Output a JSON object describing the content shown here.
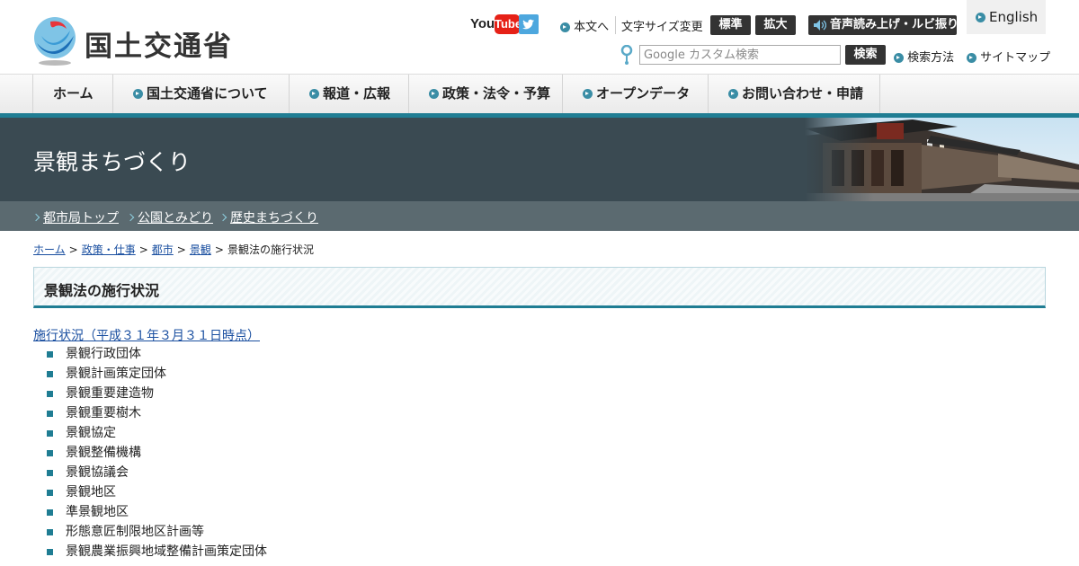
{
  "header": {
    "logo_text": "国土交通省",
    "youtube_you": "You",
    "youtube_tube": "Tube",
    "skip_link": "本文へ",
    "font_size_label": "文字サイズ変更",
    "font_standard": "標準",
    "font_large": "拡大",
    "voice_button": "音声読み上げ・ルビ振り",
    "english": "English",
    "search_placeholder": "Google カスタム検索",
    "search_button": "検索",
    "search_help": "検索方法",
    "sitemap": "サイトマップ"
  },
  "nav": {
    "items": [
      {
        "label": "ホーム"
      },
      {
        "label": "国土交通省について"
      },
      {
        "label": "報道・広報"
      },
      {
        "label": "政策・法令・予算"
      },
      {
        "label": "オープンデータ"
      },
      {
        "label": "お問い合わせ・申請"
      }
    ]
  },
  "banner": {
    "title": "景観まちづくり"
  },
  "subnav": {
    "items": [
      {
        "label": "都市局トップ"
      },
      {
        "label": "公園とみどり"
      },
      {
        "label": "歴史まちづくり"
      }
    ]
  },
  "breadcrumb": {
    "items": [
      "ホーム",
      "政策・仕事",
      "都市",
      "景観"
    ],
    "current": "景観法の施行状況",
    "separator": ">"
  },
  "page": {
    "title": "景観法の施行状況",
    "status_link": "施行状況（平成３１年３月３１日時点）",
    "items": [
      "景観行政団体",
      "景観計画策定団体",
      "景観重要建造物",
      "景観重要樹木",
      "景観協定",
      "景観整備機構",
      "景観協議会",
      "景観地区",
      "準景観地区",
      "形態意匠制限地区計画等",
      "景観農業振興地域整備計画策定団体"
    ]
  },
  "colors": {
    "accent": "#1f7d93",
    "banner_bg": "#3a4a52",
    "subnav_bg": "#5b6a70",
    "link": "#1a4fa0"
  }
}
